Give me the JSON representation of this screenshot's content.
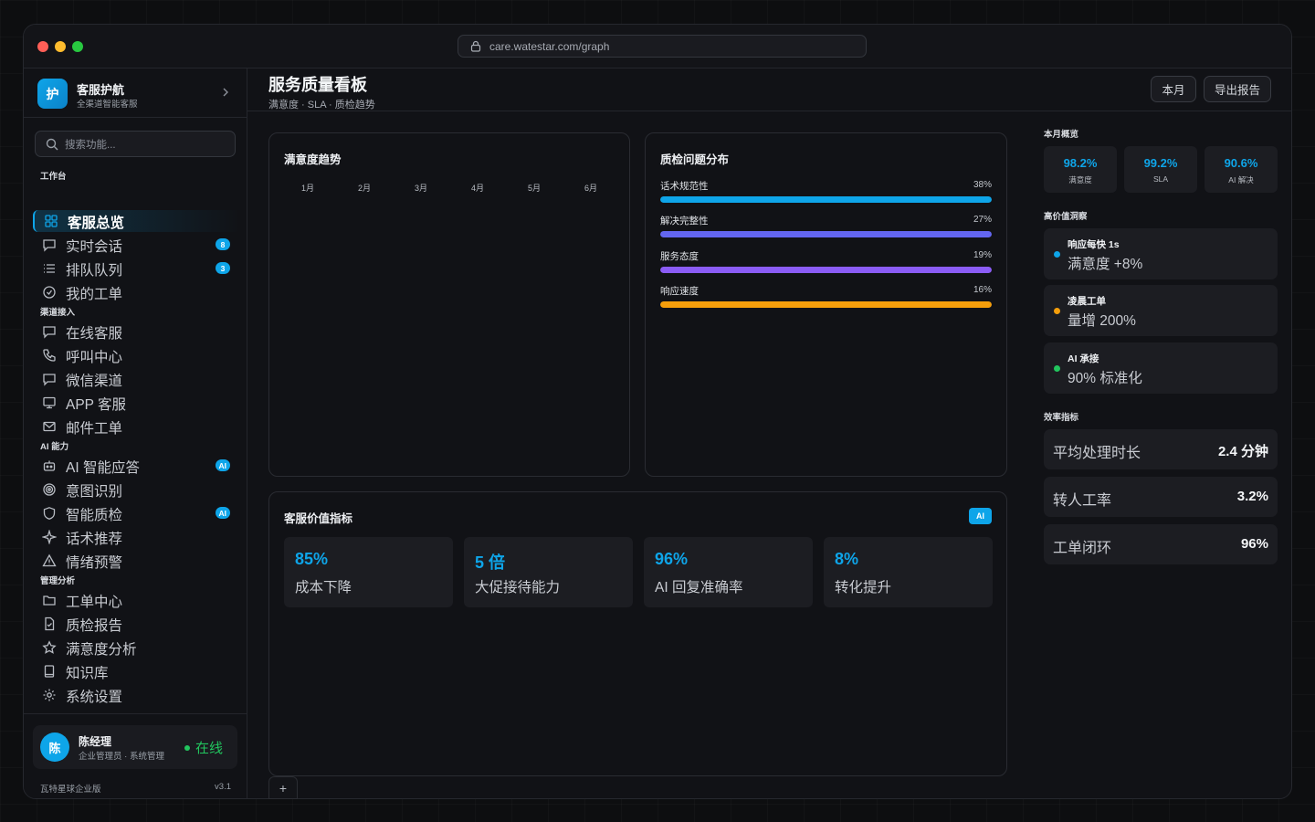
{
  "browser": {
    "url": "care.watestar.com/graph"
  },
  "brand": {
    "logo_text": "护",
    "name": "客服护航",
    "subtitle": "全渠道智能客服"
  },
  "search": {
    "placeholder": "搜索功能..."
  },
  "sections": {
    "workbench": "工作台",
    "channels": "渠道接入",
    "ai": "AI 能力",
    "management": "管理分析"
  },
  "nav": {
    "overview": "客服总览",
    "live_chat": "实时会话",
    "live_chat_badge": "8",
    "queue": "排队队列",
    "queue_badge": "3",
    "my_tickets": "我的工单",
    "online": "在线客服",
    "call_center": "呼叫中心",
    "wechat": "微信渠道",
    "app": "APP 客服",
    "email": "邮件工单",
    "ai_reply": "AI 智能应答",
    "ai_reply_badge": "AI",
    "intent": "意图识别",
    "qa": "智能质检",
    "qa_badge": "AI",
    "script": "话术推荐",
    "emotion": "情绪预警",
    "ticket_center": "工单中心",
    "qa_report": "质检报告",
    "satisfaction": "满意度分析",
    "knowledge": "知识库",
    "settings": "系统设置"
  },
  "user": {
    "avatar": "陈",
    "name": "陈经理",
    "role": "企业管理员 · 系统管理",
    "status": "在线",
    "edition": "瓦特星球企业版",
    "version": "v3.1"
  },
  "header": {
    "title": "服务质量看板",
    "subtitle": "满意度 · SLA · 质检趋势",
    "btn_month": "本月",
    "btn_export": "导出报告"
  },
  "trend": {
    "title": "满意度趋势",
    "months": [
      "1月",
      "2月",
      "3月",
      "4月",
      "5月",
      "6月"
    ]
  },
  "quality": {
    "title": "质检问题分布",
    "items": [
      {
        "label": "话术规范性",
        "value": "38%",
        "pct": 100,
        "color": "#0ea5e9"
      },
      {
        "label": "解决完整性",
        "value": "27%",
        "pct": 100,
        "color": "#6366f1"
      },
      {
        "label": "服务态度",
        "value": "19%",
        "pct": 100,
        "color": "#8b5cf6"
      },
      {
        "label": "响应速度",
        "value": "16%",
        "pct": 100,
        "color": "#f59e0b"
      }
    ]
  },
  "value": {
    "title": "客服价值指标",
    "chip": "AI",
    "cards": [
      {
        "value": "85%",
        "label": "成本下降"
      },
      {
        "value": "5 倍",
        "label": "大促接待能力"
      },
      {
        "value": "96%",
        "label": "AI 回复准确率"
      },
      {
        "value": "8%",
        "label": "转化提升"
      }
    ]
  },
  "add_tab": "+",
  "right": {
    "overview_title": "本月概览",
    "stats": [
      {
        "value": "98.2%",
        "label": "满意度"
      },
      {
        "value": "99.2%",
        "label": "SLA"
      },
      {
        "value": "90.6%",
        "label": "AI 解决"
      }
    ],
    "insight_title": "高价值洞察",
    "insights": [
      {
        "title": "响应每快 1s",
        "value": "满意度 +8%",
        "color": "#0ea5e9"
      },
      {
        "title": "凌晨工单",
        "value": "量增 200%",
        "color": "#f59e0b"
      },
      {
        "title": "AI 承接",
        "value": "90% 标准化",
        "color": "#22c55e"
      }
    ],
    "efficiency_title": "效率指标",
    "efficiency": [
      {
        "label": "平均处理时长",
        "value": "2.4 分钟"
      },
      {
        "label": "转人工率",
        "value": "3.2%"
      },
      {
        "label": "工单闭环",
        "value": "96%"
      }
    ]
  }
}
